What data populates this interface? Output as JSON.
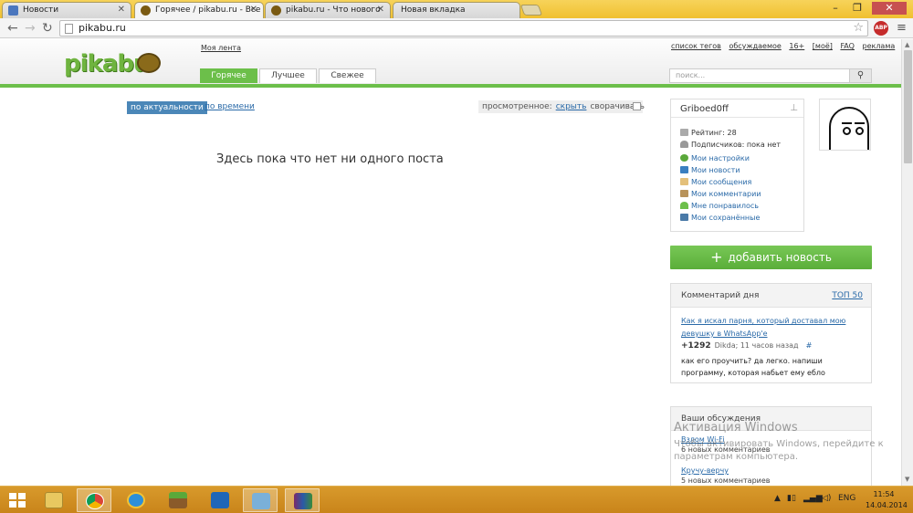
{
  "browser": {
    "tabs": [
      {
        "label": "Новости",
        "favicon_color": "#4b77be"
      },
      {
        "label": "Горячее / pikabu.ru - Все",
        "favicon_color": "#7a5a12"
      },
      {
        "label": "pikabu.ru - Что нового",
        "favicon_color": "#7a5a12"
      },
      {
        "label": "Новая вкладка",
        "favicon_color": ""
      }
    ],
    "url": "pikabu.ru",
    "abp_label": "ABP"
  },
  "site": {
    "logo": "pikabu",
    "my_feed": "Моя лента",
    "top_links": [
      "список тегов",
      "обсуждаемое",
      "16+",
      "[моё]",
      "FAQ",
      "реклама"
    ],
    "nav_tabs": [
      "Горячее",
      "Лучшее",
      "Свежее"
    ],
    "search_placeholder": "поиск...",
    "sort": {
      "active": "по актуальности",
      "other": "по времени"
    },
    "viewed": {
      "label": "просмотренное:",
      "hide": "скрыть",
      "collapse": "сворачивать"
    },
    "empty_message": "Здесь пока что нет ни одного поста"
  },
  "user": {
    "name": "Griboed0ff",
    "rating": "Рейтинг: 28",
    "subscribers": "Подписчиков: пока нет",
    "links": [
      "Мои настройки",
      "Мои новости",
      "Мои сообщения",
      "Мои комментарии",
      "Мне понравилось",
      "Мои сохранённые"
    ]
  },
  "add_news": "добавить новость",
  "comment_of_day": {
    "title": "Комментарий дня",
    "top_link": "ТОП 50",
    "post_title": "Как я искал парня, который доставал мою девушку в WhatsApp'e",
    "score": "+1292",
    "author_time": "Dikda; 11 часов назад",
    "hash": "#",
    "text": "как его проучить? да легко. напиши программу, которая набьет ему ебло"
  },
  "discussions": {
    "title": "Ваши обсуждения",
    "items": [
      {
        "title": "Взлом Wi-Fi",
        "count": "6 новых комментариев"
      },
      {
        "title": "Кручу-верчу",
        "count": "5 новых комментариев"
      }
    ]
  },
  "watermark": {
    "title": "Активация Windows",
    "text": "Чтобы активировать Windows, перейдите к параметрам компьютера."
  },
  "taskbar": {
    "lang": "ENG",
    "time": "11:54",
    "date": "14.04.2014"
  }
}
